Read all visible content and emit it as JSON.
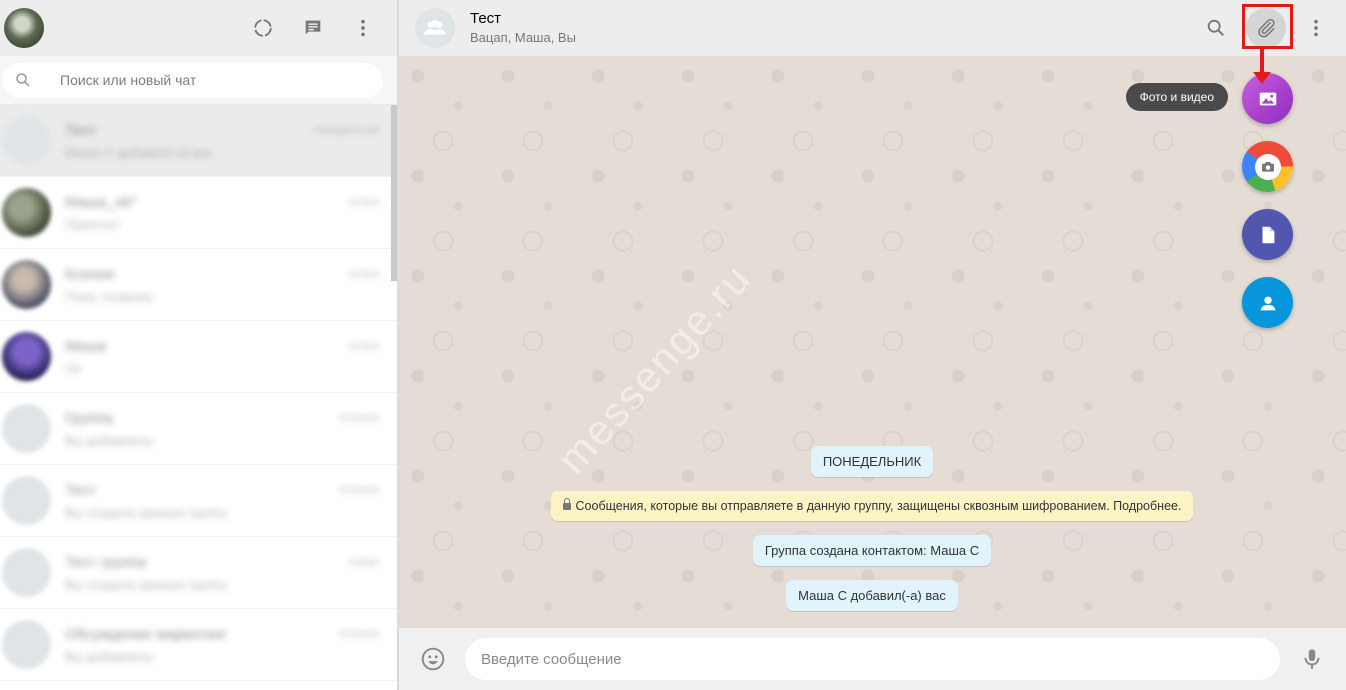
{
  "left": {
    "search_placeholder": "Поиск или новый чат",
    "chats": [
      {
        "name": "Тест",
        "time": "понедельник",
        "last": "Маша С добавил(-а) вас"
      },
      {
        "name": "Маша_ok*",
        "time": "вчера",
        "last": "Приятно!"
      },
      {
        "name": "Ксения",
        "time": "вчера",
        "last": "Пока, позвоню"
      },
      {
        "name": "Миша",
        "time": "вчера",
        "last": "Ок"
      },
      {
        "name": "Группа",
        "time": "вторник",
        "last": "Вы добавлены"
      },
      {
        "name": "Тест",
        "time": "вторник",
        "last": "Вы создали данную группу"
      },
      {
        "name": "Тест группа",
        "time": "среда",
        "last": "Вы создали данную группу"
      },
      {
        "name": "Обсуждение маркетинг",
        "time": "вторник",
        "last": "Вы добавлены"
      }
    ]
  },
  "conversation": {
    "title": "Тест",
    "subtitle": "Вацап, Маша, Вы"
  },
  "attach_menu": {
    "tooltip": "Фото и видео",
    "items": [
      "photo-video",
      "camera",
      "document",
      "contact"
    ]
  },
  "messages": {
    "day": "ПОНЕДЕЛЬНИК",
    "encryption_notice": "Сообщения, которые вы отправляете в данную группу, защищены сквозным шифрованием. Подробнее.",
    "created": "Группа создана контактом: Маша С",
    "added": "Маша С добавил(-а) вас"
  },
  "watermark": "messenge.ru",
  "compose": {
    "placeholder": "Введите сообщение"
  },
  "colors": {
    "highlight": "#e01a1a",
    "chat_bg": "#e5ddd5",
    "system_bubble": "#e1f3fb",
    "notice_bubble": "#fdf4c5"
  }
}
